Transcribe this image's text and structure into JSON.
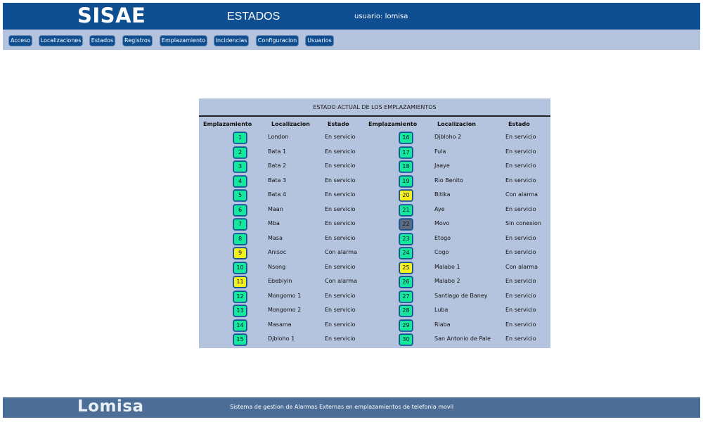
{
  "header": {
    "logo": "SISAE",
    "title": "ESTADOS",
    "user": "usuario: lomisa"
  },
  "menu": [
    {
      "label": "Acceso"
    },
    {
      "label": "Localizaciones"
    },
    {
      "label": "Estados"
    },
    {
      "label": "Registros"
    },
    {
      "label": "Emplazamiento"
    },
    {
      "label": "Incidencias"
    },
    {
      "label": "Configuracion"
    },
    {
      "label": "Usuarios"
    }
  ],
  "panel": {
    "title": "ESTADO ACTUAL DE LOS EMPLAZAMIENTOS",
    "headers": {
      "emplazamiento": "Emplazamiento",
      "localizacion": "Localizacion",
      "estado": "Estado"
    }
  },
  "status_colors": {
    "En servicio": "#14e89a",
    "Con alarma": "#f5f01a",
    "Sin conexion": "#5d6b7e"
  },
  "sites": [
    {
      "id": "1",
      "loc": "London",
      "estado": "En servicio"
    },
    {
      "id": "2",
      "loc": "Bata 1",
      "estado": "En servicio"
    },
    {
      "id": "3",
      "loc": "Bata 2",
      "estado": "En servicio"
    },
    {
      "id": "4",
      "loc": "Bata 3",
      "estado": "En servicio"
    },
    {
      "id": "5",
      "loc": "Bata 4",
      "estado": "En servicio"
    },
    {
      "id": "6",
      "loc": "Maan",
      "estado": "En servicio"
    },
    {
      "id": "7",
      "loc": "Mba",
      "estado": "En servicio"
    },
    {
      "id": "8",
      "loc": "Masa",
      "estado": "En servicio"
    },
    {
      "id": "9",
      "loc": "Anisoc",
      "estado": "Con alarma"
    },
    {
      "id": "10",
      "loc": "Nsong",
      "estado": "En servicio"
    },
    {
      "id": "11",
      "loc": "Ebebiyin",
      "estado": "Con alarma"
    },
    {
      "id": "12",
      "loc": "Mongomo 1",
      "estado": "En servicio"
    },
    {
      "id": "13",
      "loc": "Mongomo 2",
      "estado": "En servicio"
    },
    {
      "id": "14",
      "loc": "Masama",
      "estado": "En servicio"
    },
    {
      "id": "15",
      "loc": "Djbloho 1",
      "estado": "En servicio"
    },
    {
      "id": "16",
      "loc": "Djbloho 2",
      "estado": "En servicio"
    },
    {
      "id": "17",
      "loc": "Fula",
      "estado": "En servicio"
    },
    {
      "id": "18",
      "loc": "Jaaye",
      "estado": "En servicio"
    },
    {
      "id": "19",
      "loc": "Rio Benito",
      "estado": "En servicio"
    },
    {
      "id": "20",
      "loc": "Bitika",
      "estado": "Con alarma"
    },
    {
      "id": "21",
      "loc": "Aye",
      "estado": "En servicio"
    },
    {
      "id": "22",
      "loc": "Movo",
      "estado": "Sin conexion"
    },
    {
      "id": "23",
      "loc": "Etogo",
      "estado": "En servicio"
    },
    {
      "id": "24",
      "loc": "Cogo",
      "estado": "En servicio"
    },
    {
      "id": "25",
      "loc": "Malabo 1",
      "estado": "Con alarma"
    },
    {
      "id": "26",
      "loc": "Malabo 2",
      "estado": "En servicio"
    },
    {
      "id": "27",
      "loc": "Santiago de Baney",
      "estado": "En servicio"
    },
    {
      "id": "28",
      "loc": "Luba",
      "estado": "En servicio"
    },
    {
      "id": "29",
      "loc": "Riaba",
      "estado": "En servicio"
    },
    {
      "id": "30",
      "loc": "San Antonio de Pale",
      "estado": "En servicio"
    }
  ],
  "footer": {
    "logo": "Lomisa",
    "text": "Sistema de gestion de Alarmas Externas en emplazamientos de telefonia movil"
  }
}
